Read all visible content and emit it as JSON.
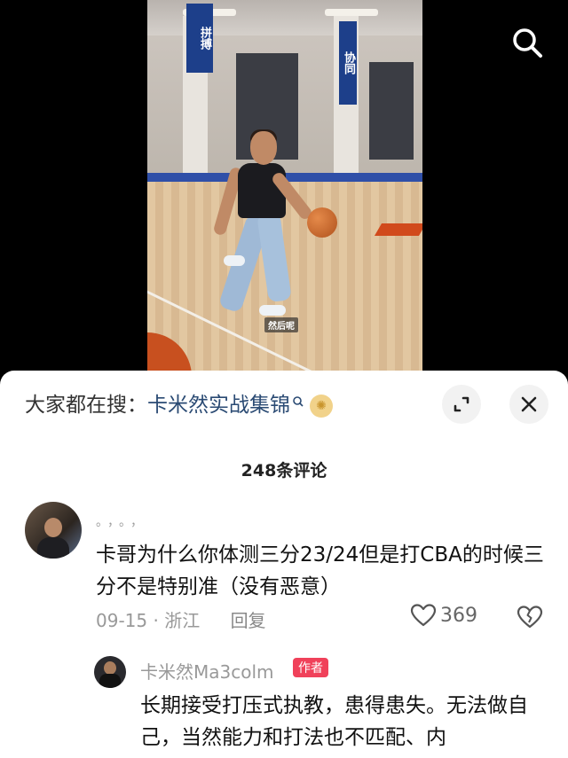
{
  "video": {
    "banner_left": "拼搏",
    "banner_right": "协同",
    "subtitle": "然后呢"
  },
  "top_bar": {
    "search_icon": "search-icon"
  },
  "search_suggestion": {
    "prefix": "大家都在搜：",
    "query": "卡米然实战集锦",
    "query_icon": "search-icon",
    "hot_icon": "hot-icon"
  },
  "panel_actions": {
    "expand_icon": "expand-icon",
    "close_icon": "close-icon"
  },
  "comments_header": {
    "count_label": "248条评论"
  },
  "comment": {
    "username": "。，。，",
    "text": "卡哥为什么你体测三分23/24但是打CBA的时候三分不是特别准（没有恶意）",
    "date": "09-15",
    "separator": "·",
    "location": "浙江",
    "reply_label": "回复",
    "like_count": "369",
    "like_icon": "heart-icon",
    "dislike_icon": "broken-heart-icon"
  },
  "reply": {
    "username": "卡米然Ma3colm",
    "badge": "作者",
    "text": "长期接受打压式执教，患得患失。无法做自己，当然能力和打法也不匹配、内"
  }
}
